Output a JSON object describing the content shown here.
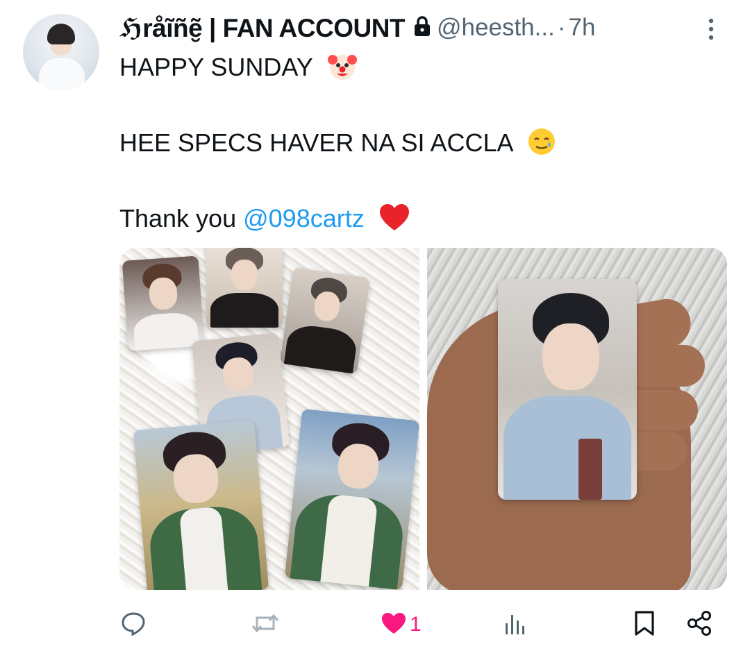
{
  "tweet": {
    "author_name": "ℌråĩñẽ̮ | FAN ACCOUNT",
    "handle": "@heesth...",
    "separator": "·",
    "time": "7h",
    "lines": [
      {
        "text": "HAPPY SUNDAY",
        "emoji": "clown-face-emoji"
      },
      {
        "text": "HEE SPECS HAVER NA SI ACCLA",
        "emoji": "smiling-face-with-tear-emoji"
      },
      {
        "text": "Thank you ",
        "mention": "@098cartz",
        "emoji": "red-heart-emoji"
      }
    ],
    "media": [
      {
        "label": "photocards-collage"
      },
      {
        "label": "photocard-in-hand"
      }
    ]
  },
  "actions": {
    "reply": {
      "icon": "reply-icon"
    },
    "retweet": {
      "icon": "retweet-icon"
    },
    "like": {
      "icon": "heart-filled-icon",
      "count": "1",
      "liked": true
    },
    "views": {
      "icon": "views-icon"
    },
    "bookmark": {
      "icon": "bookmark-icon"
    },
    "share": {
      "icon": "share-icon"
    }
  },
  "colors": {
    "text": "#0f1419",
    "secondary": "#536471",
    "accent": "#1d9bf0",
    "like": "#f91880"
  }
}
